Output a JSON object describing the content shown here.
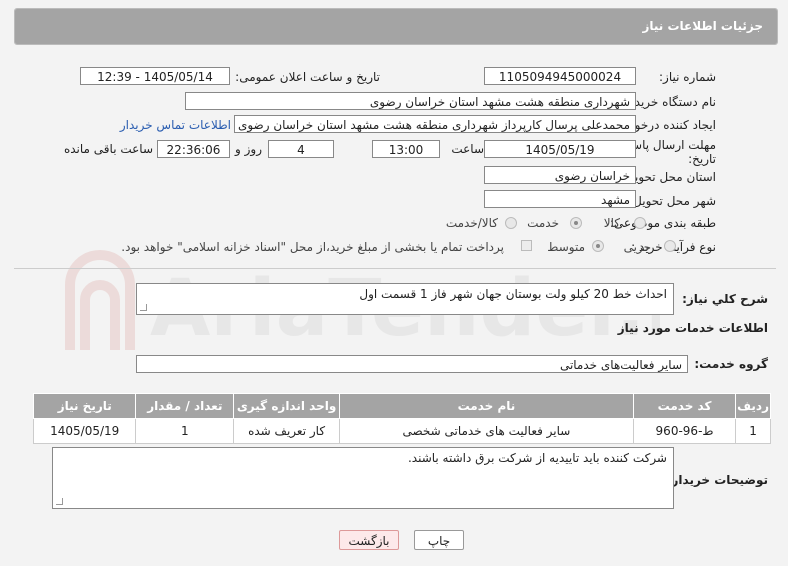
{
  "header": {
    "title": "جزئیات اطلاعات نیاز"
  },
  "fields": {
    "need_number_label": "شماره نیاز:",
    "need_number": "1105094945000024",
    "announce_label": "تاریخ و ساعت اعلان عمومی:",
    "announce_value": "1405/05/14 - 12:39",
    "buyer_org_label": "نام دستگاه خریدار:",
    "buyer_org": "شهرداری منطقه هشت مشهد استان خراسان رضوی",
    "creator_label": "ایجاد کننده درخواست:",
    "creator": "محمدعلی پرسال کارپرداز شهرداری منطقه هشت مشهد استان خراسان رضوی",
    "contact_link": "اطلاعات تماس خریدار",
    "deadline_label_1": "مهلت ارسال پاسخ: تا",
    "deadline_label_2": "تاریخ:",
    "deadline_date": "1405/05/19",
    "time_label": "ساعت",
    "deadline_time": "13:00",
    "days_value": "4",
    "days_label": "روز و",
    "remaining_time": "22:36:06",
    "remaining_label": "ساعت باقی مانده",
    "province_label": "استان محل تحویل:",
    "province": "خراسان رضوی",
    "city_label": "شهر محل تحویل:",
    "city": "مشهد",
    "category_label": "طبقه بندی موضوعی:",
    "category_options": [
      "کالا",
      "خدمت",
      "کالا/خدمت"
    ],
    "category_selected": "خدمت",
    "process_label": "نوع فرآیند خرید :",
    "process_options": [
      "جزیی",
      "متوسط"
    ],
    "process_selected": "متوسط",
    "payment_note": "پرداخت تمام یا بخشی از مبلغ خرید،از محل \"اسناد خزانه اسلامی\" خواهد بود."
  },
  "summary": {
    "label": "شرح کلي نياز:",
    "value": "احداث خط 20 کیلو ولت بوستان جهان شهر فاز 1 قسمت اول"
  },
  "services": {
    "section_title": "اطلاعات خدمات مورد نیاز",
    "group_label": "گروه خدمت:",
    "group_value": "سایر فعالیت‌های خدماتی",
    "columns": [
      "ردیف",
      "کد خدمت",
      "نام خدمت",
      "واحد اندازه گیری",
      "تعداد / مقدار",
      "تاریخ نیاز"
    ],
    "rows": [
      [
        "1",
        "ط-96-960",
        "سایر فعالیت های خدماتی شخصی",
        "کار تعریف شده",
        "1",
        "1405/05/19"
      ]
    ]
  },
  "buyer_notes": {
    "label": "توضیحات خریدار:",
    "value": "شرکت کننده باید تاییدیه از شرکت برق داشته باشند."
  },
  "buttons": {
    "print": "چاپ",
    "back": "بازگشت"
  },
  "watermark": "AriaTender.neT",
  "colors": {
    "header_bg": "#a4a4a4",
    "link": "#2a5db0",
    "back_btn_bg": "#fde9ea"
  }
}
